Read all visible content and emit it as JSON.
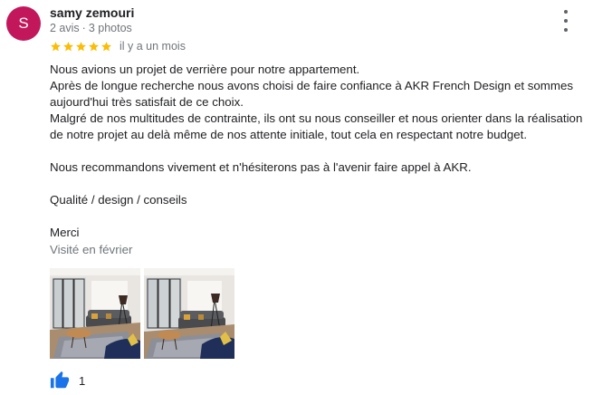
{
  "author": {
    "avatar_letter": "S",
    "avatar_color": "#c2185b",
    "name": "samy zemouri",
    "reviews_count": "2 avis",
    "separator": "·",
    "photos_count": "3 photos"
  },
  "menu_icon": "more-vert-icon",
  "rating": {
    "stars": 5,
    "max": 5,
    "star_color": "#fbbc04",
    "date": "il y a un mois"
  },
  "review": {
    "lines": [
      "Nous avions un projet de verrière pour notre appartement.",
      "Après de longue recherche nous avons choisi de faire confiance à AKR French Design et sommes aujourd'hui très satisfait de ce choix.",
      "Malgré de nos multitudes de contrainte, ils ont su nous conseiller et nous orienter dans la réalisation de notre projet au delà même de nos attente initiale, tout cela en respectant notre budget.",
      "",
      "Nous recommandons vivement et n'hésiterons pas à l'avenir faire appel à AKR.",
      "",
      "Qualité / design / conseils",
      "",
      "Merci"
    ],
    "visited": "Visité en février"
  },
  "photos": [
    {
      "name": "review-photo-1"
    },
    {
      "name": "review-photo-2"
    }
  ],
  "like": {
    "icon": "thumb-up-icon",
    "color": "#1a73e8",
    "count": "1"
  }
}
